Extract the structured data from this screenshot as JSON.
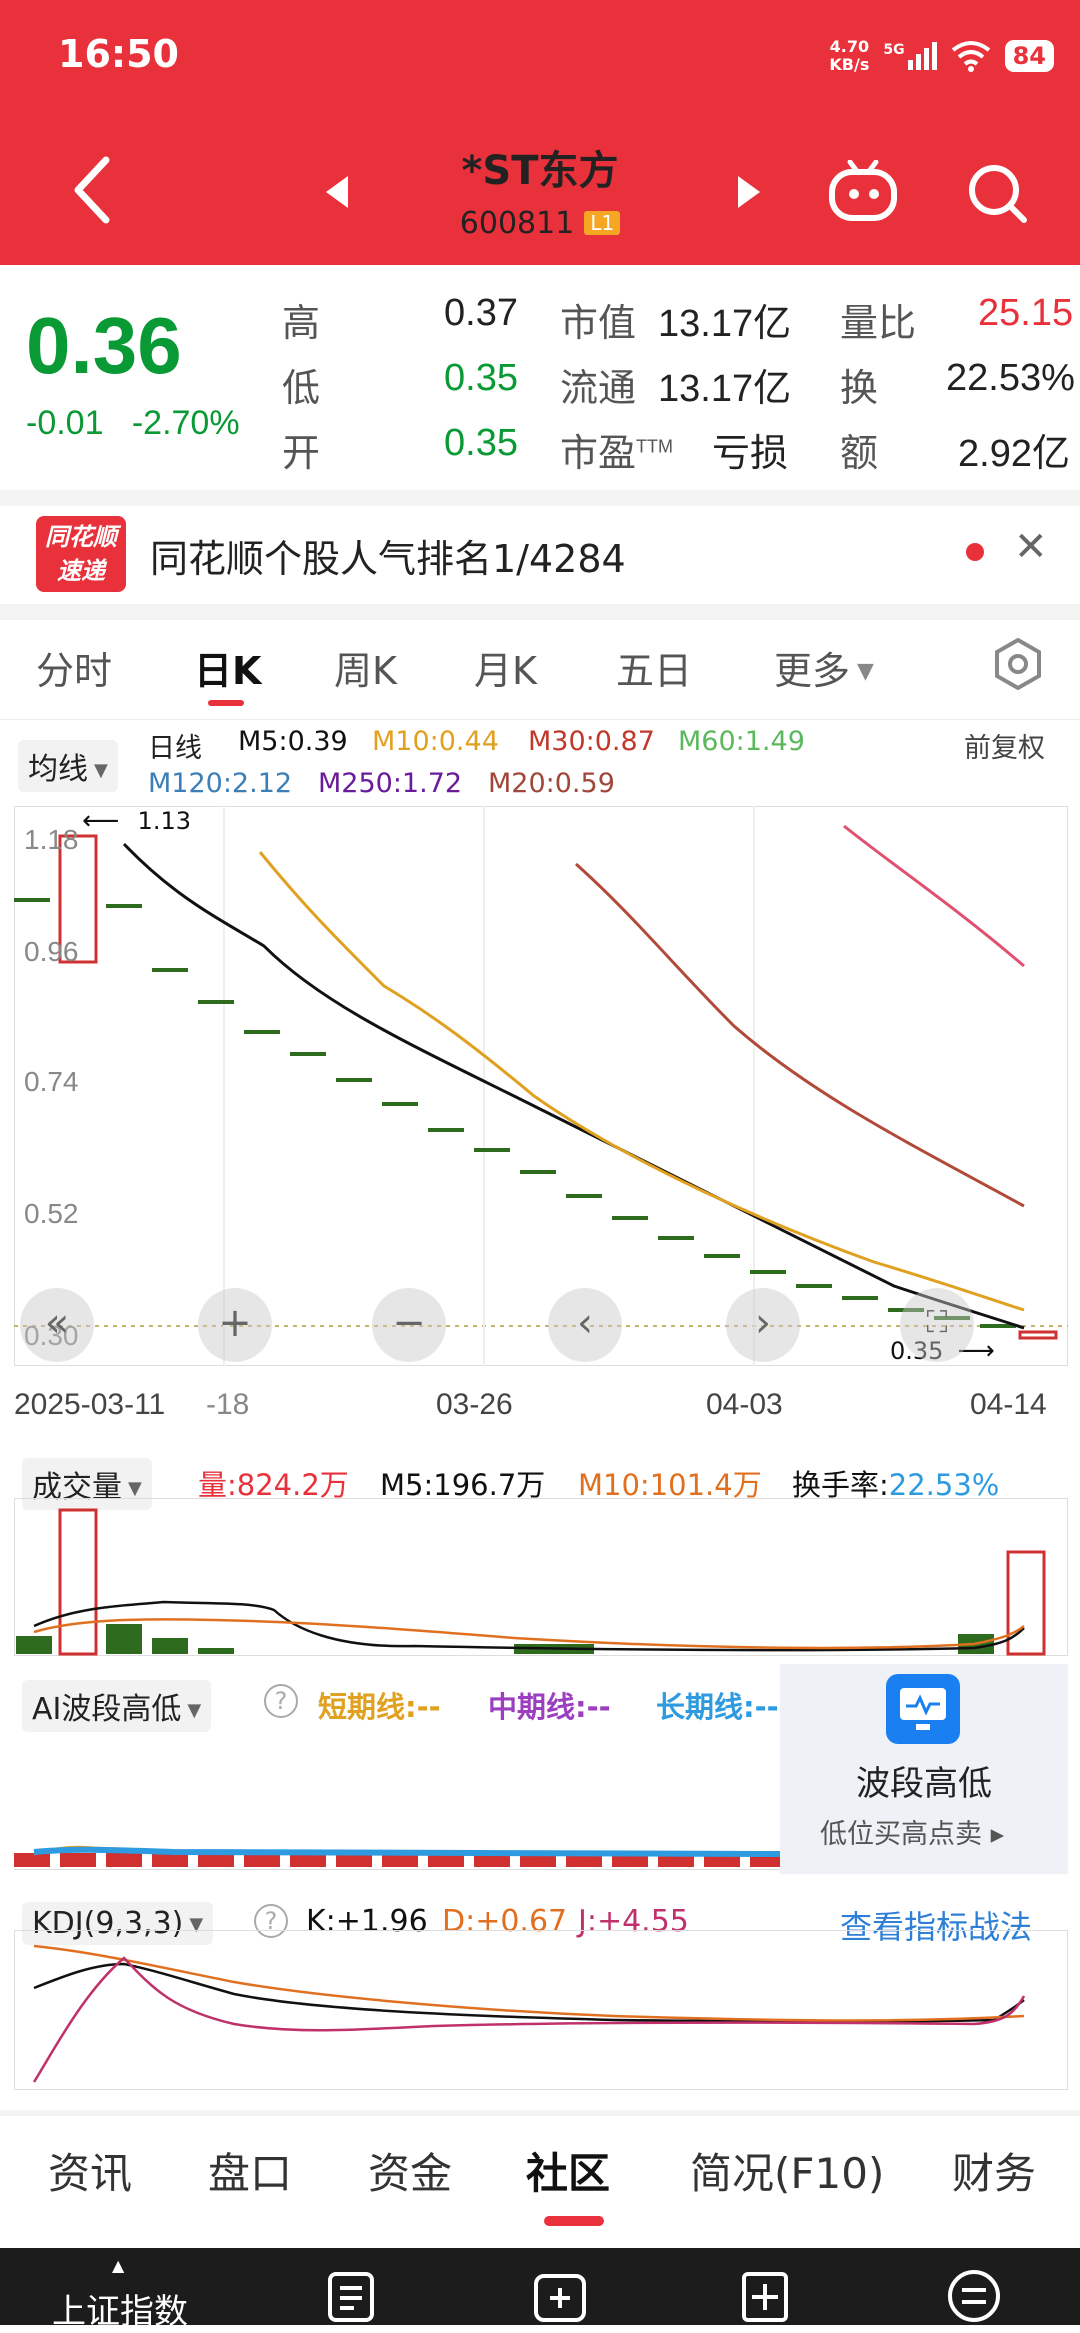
{
  "status": {
    "time": "16:50",
    "net_speed_value": "4.70",
    "net_speed_unit": "KB/s",
    "signal": "5G",
    "battery": "84"
  },
  "header": {
    "name": "*ST东方",
    "code": "600811",
    "level": "L1"
  },
  "quote": {
    "price": "0.36",
    "change": "-0.01",
    "change_pct": "-2.70%",
    "high_label": "高",
    "high": "0.37",
    "low_label": "低",
    "low": "0.35",
    "open_label": "开",
    "open": "0.35",
    "mktcap_label": "市值",
    "mktcap": "13.17亿",
    "float_label": "流通",
    "float": "13.17亿",
    "pe_label": "市盈",
    "pe_sup": "TTM",
    "pe": "亏损",
    "vr_label": "量比",
    "vr": "25.15",
    "turnover_label": "换",
    "turnover": "22.53%",
    "amount_label": "额",
    "amount": "2.92亿"
  },
  "news": {
    "logo_line1": "同花顺",
    "logo_line2": "速递",
    "text": "同花顺个股人气排名1/4284"
  },
  "tabs": [
    "分时",
    "日K",
    "周K",
    "月K",
    "五日",
    "更多"
  ],
  "ma": {
    "dropdown": "均线",
    "period": "日线",
    "m5": "M5:0.39",
    "m10": "M10:0.44",
    "m30": "M30:0.87",
    "m60": "M60:1.49",
    "m120": "M120:2.12",
    "m250": "M250:1.72",
    "m20": "M20:0.59",
    "adjust": "前复权",
    "colors": {
      "m5": "#111111",
      "m10": "#e0a020",
      "m30": "#c0392b",
      "m60": "#5cb85c",
      "m120": "#3c7fb8",
      "m250": "#6a1b9a",
      "m20": "#a0473a"
    }
  },
  "kchart": {
    "y_ticks": [
      "1.18",
      "0.96",
      "0.74",
      "0.52",
      "0.30"
    ],
    "x_ticks": [
      "2025-03-11",
      "-18",
      "03-26",
      "04-03",
      "04-14"
    ],
    "max_label": "1.13",
    "min_label": "0.35"
  },
  "volume": {
    "dropdown": "成交量",
    "vol": "量:824.2万",
    "m5": "M5:196.7万",
    "m10": "M10:101.4万",
    "turnover_label": "换手率:",
    "turnover": "22.53%"
  },
  "ai": {
    "dropdown": "AI波段高低",
    "short": "短期线:--",
    "mid": "中期线:--",
    "long": "长期线:--",
    "promo_title": "波段高低",
    "promo_sub": "低位买高点卖"
  },
  "kdj": {
    "dropdown": "KDJ(9,3,3)",
    "k": "K:+1.96",
    "d": "D:+0.67",
    "j": "J:+4.55",
    "link": "查看指标战法"
  },
  "bottom_tabs": [
    "资讯",
    "盘口",
    "资金",
    "社区",
    "简况(F10)",
    "财务"
  ],
  "bottom_bar": {
    "index_label": "上证指数"
  }
}
